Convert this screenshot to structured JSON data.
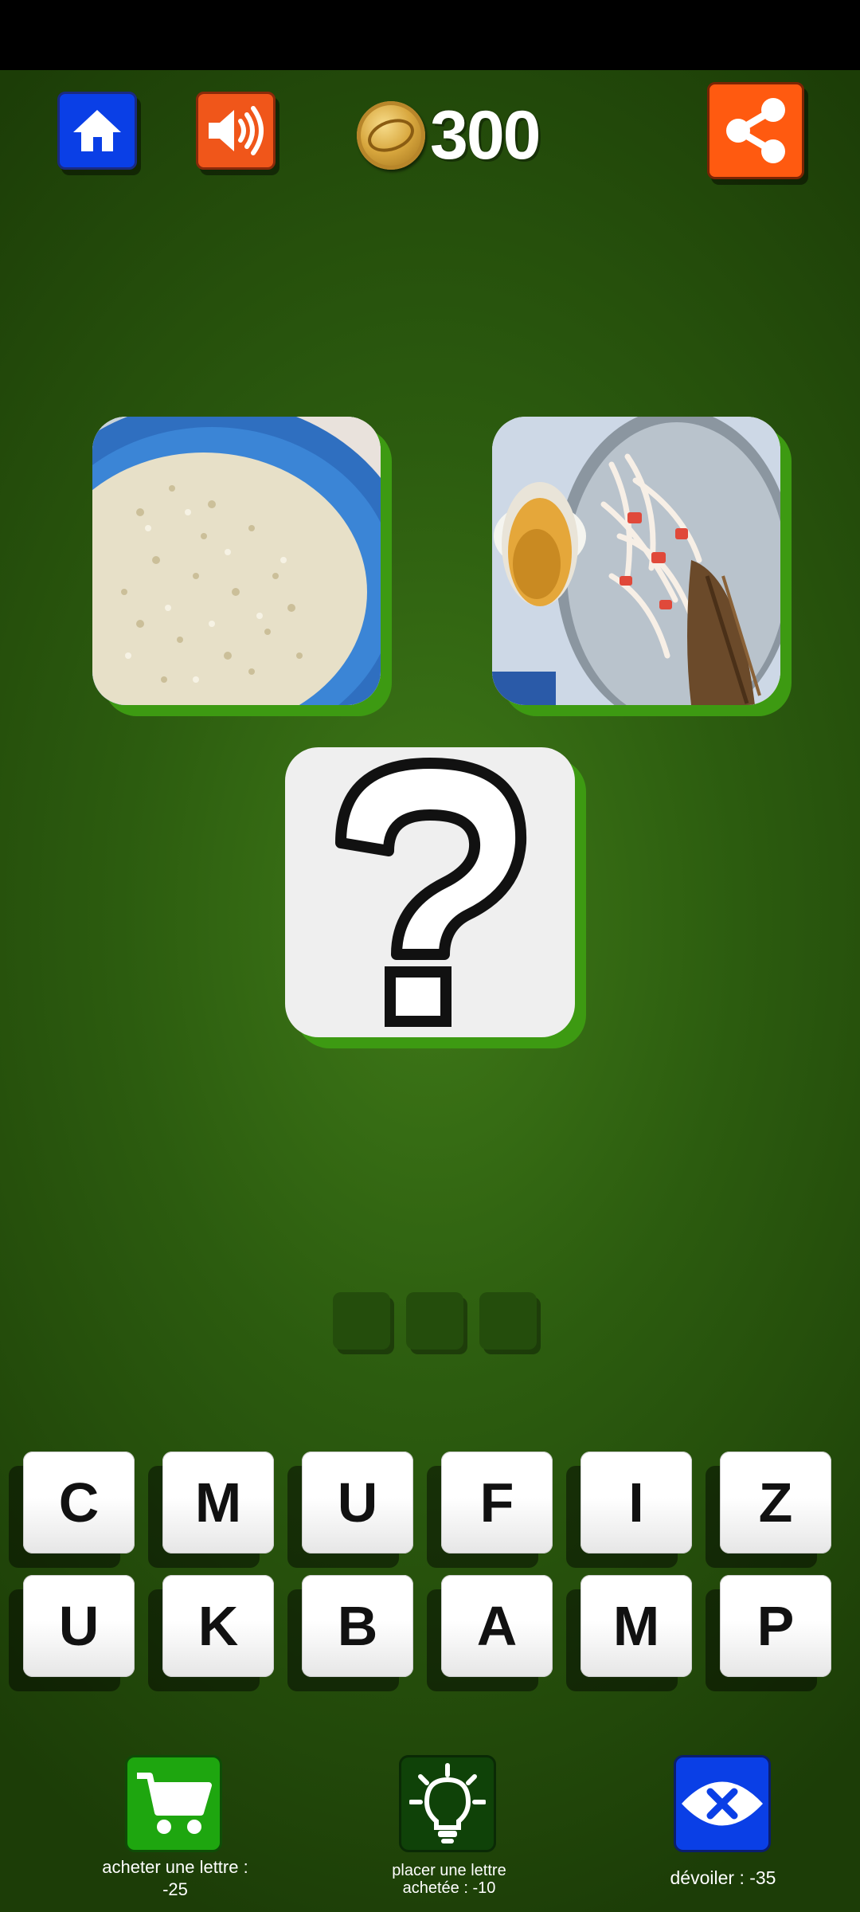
{
  "header": {
    "icons": {
      "home": "home-icon",
      "sound": "speaker-icon",
      "share": "share-icon",
      "coin": "coin-icon"
    },
    "coins": "300"
  },
  "puzzle": {
    "images": [
      "rice-dish-image",
      "fish-salad-dish-image",
      "question-mark-image"
    ]
  },
  "answer": {
    "slots": [
      "",
      "",
      ""
    ]
  },
  "keyboard": {
    "row1": [
      "C",
      "M",
      "U",
      "F",
      "I",
      "Z"
    ],
    "row2": [
      "U",
      "K",
      "B",
      "A",
      "M",
      "P"
    ]
  },
  "actions": {
    "buy_letter": "acheter une lettre :\n-25",
    "place_letter": "placer une lettre\nachetée : -10",
    "reveal": "dévoiler : -35"
  },
  "colors": {
    "home_button": "#0a3fe6",
    "sound_button": "#f0561a",
    "share_button": "#ff5a10",
    "cart_button": "#1ea60f",
    "hint_button": "#0f4208",
    "reveal_button": "#0a3fe6",
    "tile_shadow": "#3d9a12"
  }
}
